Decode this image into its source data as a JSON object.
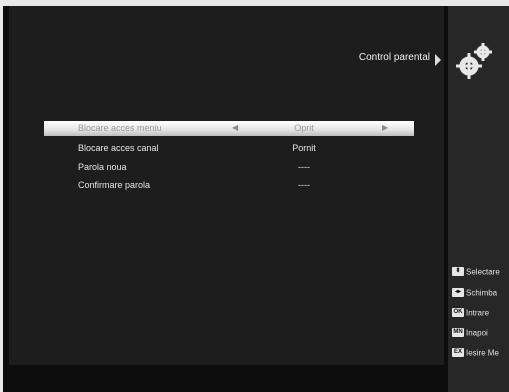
{
  "header": {
    "title": "Control parental",
    "icon": "gears-icon"
  },
  "menu": [
    {
      "label": "Blocare acces meniu",
      "value": "Oprit",
      "selected": true
    },
    {
      "label": "Blocare acces canal",
      "value": "Pornit",
      "selected": false
    },
    {
      "label": "Parola noua",
      "value": "----",
      "selected": false
    },
    {
      "label": "Confirmare parola",
      "value": "----",
      "selected": false
    }
  ],
  "legend": [
    {
      "key": "up-down-keys-icon",
      "label": "Selectare"
    },
    {
      "key": "left-right-keys-icon",
      "label": "Schimba"
    },
    {
      "key": "ok-key-icon",
      "label": "Intrare"
    },
    {
      "key": "menu-key-icon",
      "label": "Inapoi"
    },
    {
      "key": "exit-key-icon",
      "label": "Iesire Me"
    }
  ],
  "colors": {
    "background": "#1d1d1d",
    "selected_bar": "#ffffff",
    "text": "#e6e6e6"
  }
}
